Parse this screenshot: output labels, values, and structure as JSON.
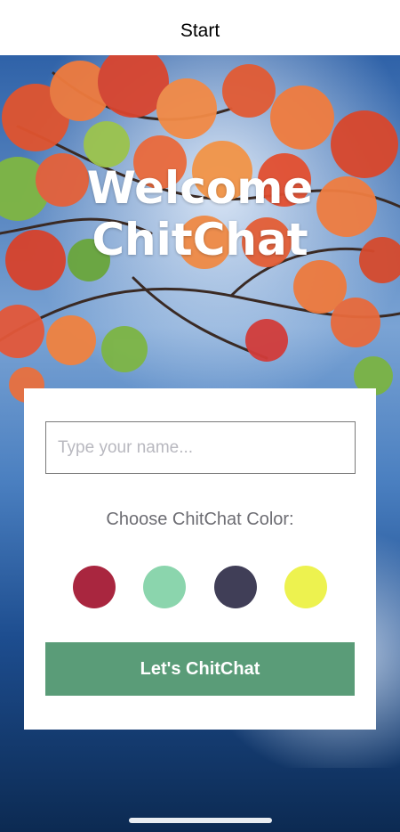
{
  "nav": {
    "title": "Start"
  },
  "welcome": {
    "line1": "Welcome",
    "line2": "ChitChat"
  },
  "form": {
    "name_placeholder": "Type your name...",
    "name_value": "",
    "color_label": "Choose ChitChat Color:",
    "colors": [
      {
        "name": "crimson",
        "hex": "#A9263F"
      },
      {
        "name": "mint",
        "hex": "#8BD5AD"
      },
      {
        "name": "dark-slate",
        "hex": "#403E57"
      },
      {
        "name": "yellow",
        "hex": "#EDF24F"
      }
    ],
    "submit_label": "Let's ChitChat",
    "submit_color": "#5A9C78"
  },
  "background": {
    "image": "autumn-maple-leaves-photo"
  }
}
